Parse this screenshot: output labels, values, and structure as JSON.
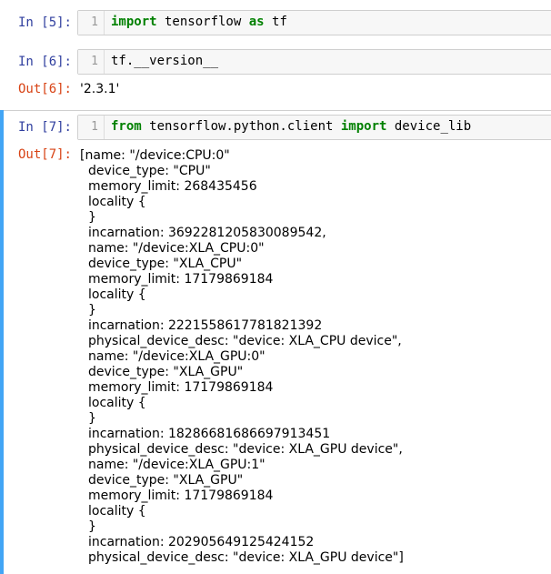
{
  "cells": [
    {
      "in_prompt": "In [5]:",
      "line_number": "1",
      "code": [
        {
          "text": "import",
          "kw": true
        },
        {
          "text": " tensorflow ",
          "kw": false
        },
        {
          "text": "as",
          "kw": true
        },
        {
          "text": " tf",
          "kw": false
        }
      ]
    },
    {
      "in_prompt": "In [6]:",
      "line_number": "1",
      "code": [
        {
          "text": "tf.__version__",
          "kw": false
        }
      ],
      "out_prompt": "Out[6]:",
      "output": "'2.3.1'"
    },
    {
      "in_prompt": "In [7]:",
      "line_number": "1",
      "code": [
        {
          "text": "from",
          "kw": true
        },
        {
          "text": " tensorflow.python.client ",
          "kw": false
        },
        {
          "text": "import",
          "kw": true
        },
        {
          "text": " device_lib",
          "kw": false
        }
      ],
      "out_prompt": "Out[7]:",
      "output_lines": [
        "[name: \"/device:CPU:0\"",
        "device_type: \"CPU\"",
        "memory_limit: 268435456",
        "locality {",
        "}",
        "incarnation: 3692281205830089542,",
        "name: \"/device:XLA_CPU:0\"",
        "device_type: \"XLA_CPU\"",
        "memory_limit: 17179869184",
        "locality {",
        "}",
        "incarnation: 2221558617781821392",
        "physical_device_desc: \"device: XLA_CPU device\",",
        "name: \"/device:XLA_GPU:0\"",
        "device_type: \"XLA_GPU\"",
        "memory_limit: 17179869184",
        "locality {",
        "}",
        "incarnation: 18286681686697913451",
        "physical_device_desc: \"device: XLA_GPU device\",",
        "name: \"/device:XLA_GPU:1\"",
        "device_type: \"XLA_GPU\"",
        "memory_limit: 17179869184",
        "locality {",
        "}",
        "incarnation: 202905649125424152",
        "physical_device_desc: \"device: XLA_GPU device\"]"
      ]
    }
  ],
  "colors": {
    "in_prompt": "#303f9f",
    "out_prompt": "#d84315",
    "keyword": "#008000",
    "selected_bar": "#42a5f5"
  }
}
